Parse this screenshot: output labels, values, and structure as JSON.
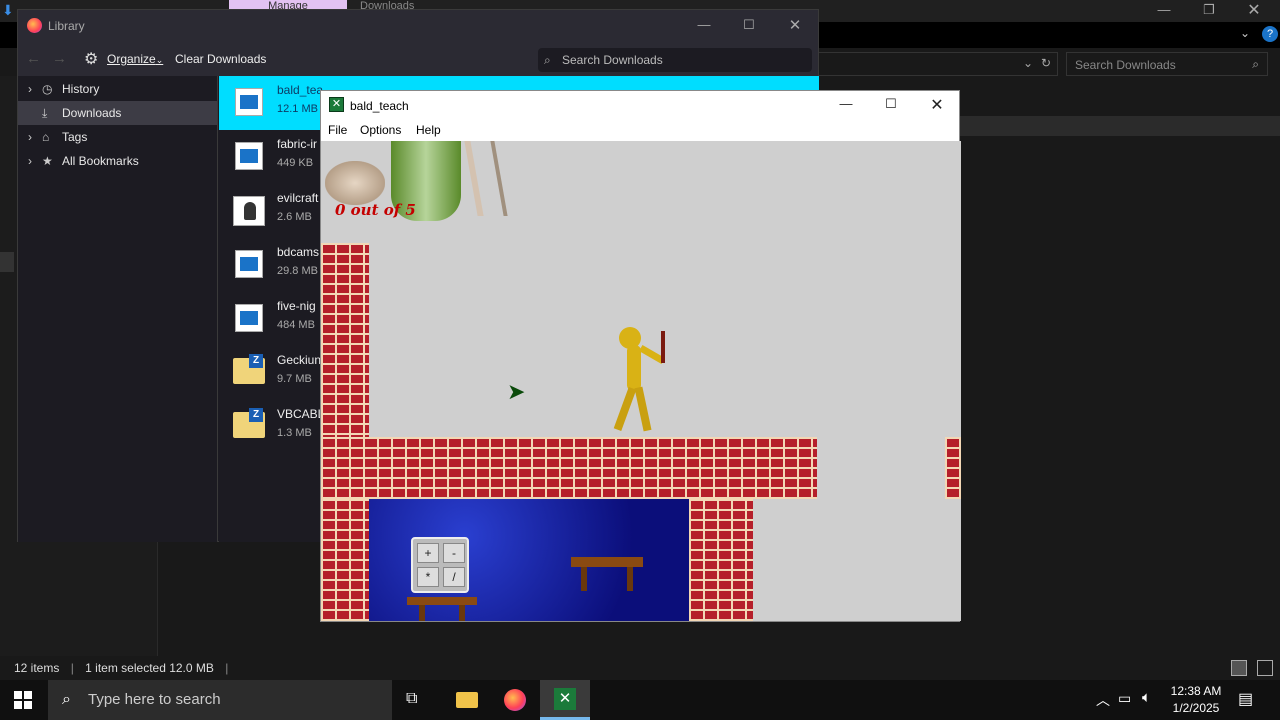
{
  "explorer": {
    "ribbon_tabs": [
      "Manage",
      "Downloads"
    ],
    "search_placeholder": "Search Downloads",
    "status": {
      "items": "12 items",
      "selected": "1 item selected  12.0 MB"
    }
  },
  "library": {
    "title": "Library",
    "toolbar": {
      "organize": "Organize",
      "clear": "Clear Downloads",
      "search_placeholder": "Search Downloads"
    },
    "sidebar": [
      {
        "label": "History",
        "icon": "clock-icon"
      },
      {
        "label": "Downloads",
        "icon": "download-icon"
      },
      {
        "label": "Tags",
        "icon": "tag-icon"
      },
      {
        "label": "All Bookmarks",
        "icon": "star-icon"
      }
    ],
    "downloads": [
      {
        "name": "bald_tea",
        "size": "12.1 MB",
        "icon": "installer-icon"
      },
      {
        "name": "fabric-ir",
        "size": "449 KB",
        "icon": "installer-icon"
      },
      {
        "name": "evilcraft",
        "size": "2.6 MB",
        "icon": "java-icon"
      },
      {
        "name": "bdcams",
        "size": "29.8 MB",
        "icon": "installer-icon"
      },
      {
        "name": "five-nig",
        "size": "484 MB",
        "icon": "installer-icon"
      },
      {
        "name": "Geckiun",
        "size": "9.7 MB",
        "icon": "zip-folder-icon"
      },
      {
        "name": "VBCABL",
        "size": "1.3 MB",
        "icon": "zip-folder-icon"
      }
    ]
  },
  "game": {
    "title": "bald_teach",
    "menu": [
      "File",
      "Options",
      "Help"
    ],
    "hud_text": "0 out of 5",
    "keypad_keys": [
      "+",
      "-",
      "*",
      "/"
    ]
  },
  "taskbar": {
    "search_placeholder": "Type here to search",
    "time": "12:38 AM",
    "date": "1/2/2025"
  }
}
